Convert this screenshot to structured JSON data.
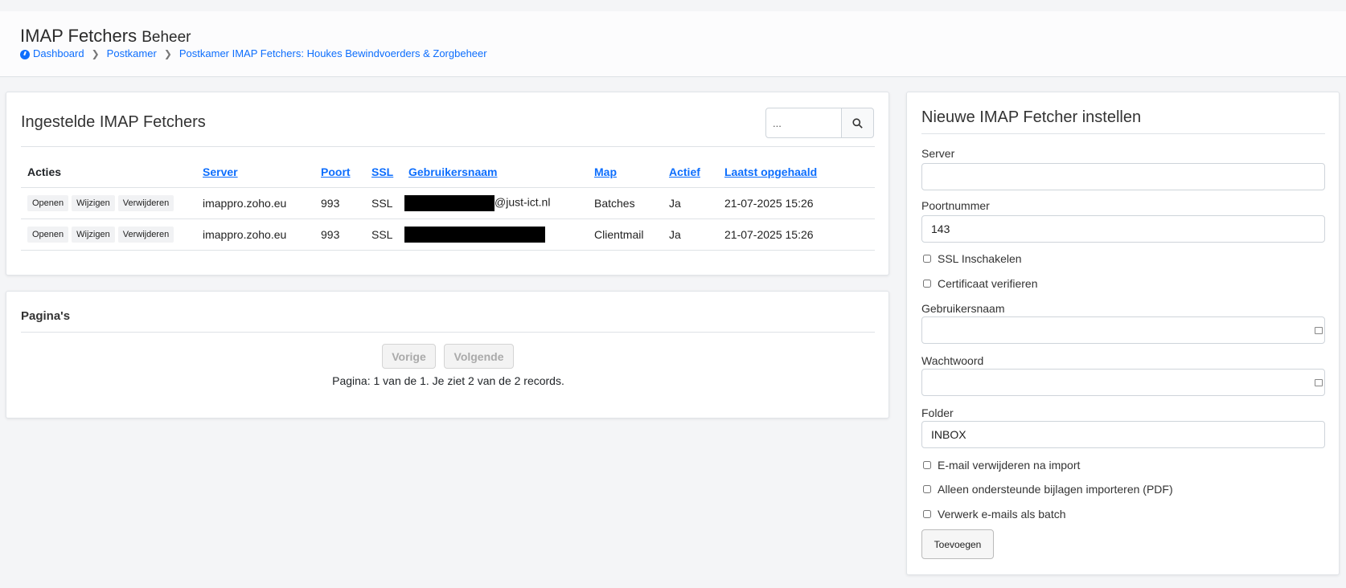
{
  "header": {
    "title": "IMAP Fetchers",
    "subtitle": "Beheer",
    "breadcrumb": [
      "Dashboard",
      "Postkamer",
      "Postkamer IMAP Fetchers: Houkes Bewindvoerders & Zorgbeheer"
    ]
  },
  "list": {
    "title": "Ingestelde IMAP Fetchers",
    "search_value": "...",
    "columns": [
      "Acties",
      "Server",
      "Poort",
      "SSL",
      "Gebruikersnaam",
      "Map",
      "Actief",
      "Laatst opgehaald"
    ],
    "action_labels": [
      "Openen",
      "Wijzigen",
      "Verwijderen"
    ],
    "rows": [
      {
        "server": "imappro.zoho.eu",
        "port": "993",
        "ssl": "SSL",
        "username_suffix": "@just-ict.nl",
        "map": "Batches",
        "active": "Ja",
        "last_fetched": "21-07-2025 15:26"
      },
      {
        "server": "imappro.zoho.eu",
        "port": "993",
        "ssl": "SSL",
        "username_suffix": "",
        "map": "Clientmail",
        "active": "Ja",
        "last_fetched": "21-07-2025 15:26"
      }
    ]
  },
  "pagination": {
    "title": "Pagina's",
    "prev_label": "Vorige",
    "next_label": "Volgende",
    "info": "Pagina: 1 van de 1. Je ziet 2 van de 2 records."
  },
  "form": {
    "title": "Nieuwe IMAP Fetcher instellen",
    "server_label": "Server",
    "server_value": "",
    "port_label": "Poortnummer",
    "port_value": "143",
    "ssl_label": "SSL Inschakelen",
    "verify_label": "Certificaat verifieren",
    "username_label": "Gebruikersnaam",
    "username_value": "",
    "password_label": "Wachtwoord",
    "password_value": "",
    "folder_label": "Folder",
    "folder_value": "INBOX",
    "delete_label": "E-mail verwijderen na import",
    "only_supported_label": "Alleen ondersteunde bijlagen importeren (PDF)",
    "batch_label": "Verwerk e-mails als batch",
    "submit_label": "Toevoegen"
  },
  "colors": {
    "link": "#0d6efd",
    "redaction": "#000000"
  }
}
